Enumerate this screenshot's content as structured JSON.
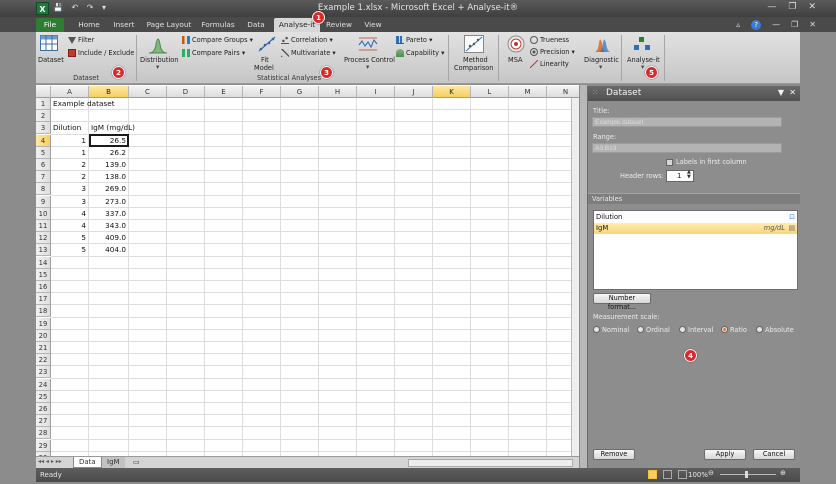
{
  "window": {
    "title": "Example 1.xlsx - Microsoft Excel + Analyse-it®",
    "app_icon": "X"
  },
  "tabs": [
    "File",
    "Home",
    "Insert",
    "Page Layout",
    "Formulas",
    "Data",
    "Analyse-it",
    "Review",
    "View"
  ],
  "active_tab": "Analyse-it",
  "ribbon": {
    "groups": {
      "dataset": {
        "label": "Dataset",
        "dataset_button": "Dataset",
        "filter": "Filter",
        "include_exclude": "Include / Exclude"
      },
      "statistical": {
        "label": "Statistical Analyses",
        "distribution": "Distribution",
        "compare_groups": "Compare Groups",
        "compare_pairs": "Compare Pairs",
        "fit_model": "Fit",
        "fit_model2": "Model",
        "correlation": "Correlation",
        "multivariate": "Multivariate",
        "process_control": "Process Control",
        "pareto": "Pareto",
        "capability": "Capability"
      },
      "method": {
        "method_comparison": "Method",
        "method_comparison2": "Comparison",
        "msa": "MSA",
        "trueness": "Trueness",
        "precision": "Precision",
        "linearity": "Linearity",
        "diagnostic": "Diagnostic",
        "analyse_it": "Analyse-it"
      }
    },
    "badges": [
      "1",
      "2",
      "3",
      "4",
      "5"
    ]
  },
  "sheet": {
    "columns": [
      "A",
      "B",
      "C",
      "D",
      "E",
      "F",
      "G",
      "H",
      "I",
      "J",
      "K",
      "L",
      "M",
      "N"
    ],
    "rows": [
      "1",
      "2",
      "3",
      "4",
      "5",
      "6",
      "7",
      "8",
      "9",
      "10",
      "11",
      "12",
      "13",
      "14",
      "15",
      "16",
      "17",
      "18",
      "19",
      "20",
      "21",
      "22",
      "23",
      "24",
      "25",
      "26",
      "27",
      "28",
      "29",
      "30"
    ],
    "title": "Example dataset",
    "headers": [
      "Dilution",
      "IgM (mg/dL)"
    ],
    "data": [
      [
        "1",
        "26.5"
      ],
      [
        "1",
        "26.2"
      ],
      [
        "2",
        "139.0"
      ],
      [
        "2",
        "138.0"
      ],
      [
        "3",
        "269.0"
      ],
      [
        "3",
        "273.0"
      ],
      [
        "4",
        "337.0"
      ],
      [
        "4",
        "343.0"
      ],
      [
        "5",
        "409.0"
      ],
      [
        "5",
        "404.0"
      ]
    ],
    "tabs": [
      "Data",
      "IgM"
    ],
    "active_sheet": "Data"
  },
  "status": {
    "ready": "Ready",
    "zoom": "100%"
  },
  "taskpane": {
    "header": "Dataset",
    "title_label": "Title:",
    "title_value": "Example dataset",
    "range_label": "Range:",
    "range_value": "A3:B13",
    "labels_first_column": "Labels in first column",
    "header_rows_label": "Header rows:",
    "header_rows_value": "1",
    "variables_label": "Variables",
    "variables": [
      {
        "name": "Dilution",
        "unit": ""
      },
      {
        "name": "IgM",
        "unit": "mg/dL"
      }
    ],
    "number_format": "Number format...",
    "measurement_scale_label": "Measurement scale:",
    "scales": [
      "Nominal",
      "Ordinal",
      "Interval",
      "Ratio",
      "Absolute"
    ],
    "selected_scale": "Ratio",
    "remove": "Remove",
    "apply": "Apply",
    "cancel": "Cancel"
  },
  "colors": {
    "file_tab": "#2e7d32",
    "selection": "#f6cf5e",
    "badge": "#d92b2b"
  }
}
